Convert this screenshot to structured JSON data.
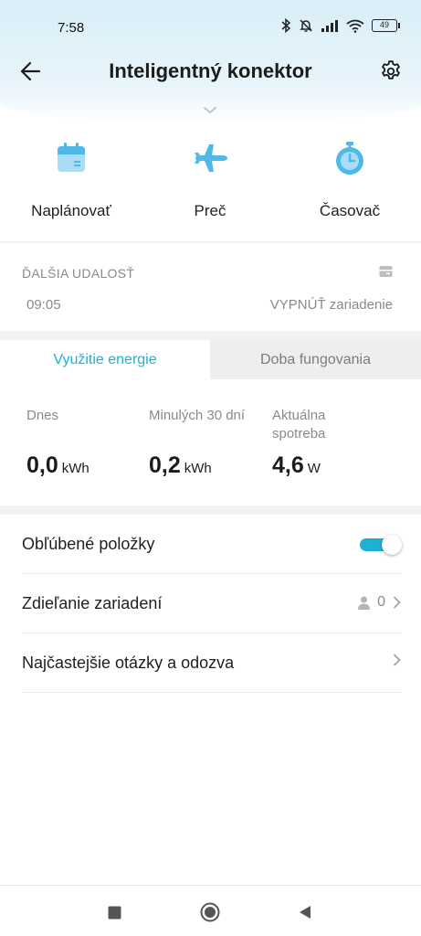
{
  "status_bar": {
    "time": "7:58",
    "battery": "49"
  },
  "header": {
    "title": "Inteligentný konektor"
  },
  "actions": [
    {
      "label": "Naplánovať",
      "icon": "calendar-icon"
    },
    {
      "label": "Preč",
      "icon": "airplane-icon"
    },
    {
      "label": "Časovač",
      "icon": "timer-icon"
    }
  ],
  "next_event": {
    "title": "ĎALŠIA UDALOSŤ",
    "time": "09:05",
    "action": "VYPNÚŤ zariadenie"
  },
  "tabs": {
    "active": "Využitie energie",
    "inactive": "Doba fungovania"
  },
  "energy": [
    {
      "label": "Dnes",
      "value": "0,0",
      "unit": "kWh"
    },
    {
      "label": "Minulých 30 dní",
      "value": "0,2",
      "unit": "kWh"
    },
    {
      "label": "Aktuálna spotreba",
      "value": "4,6",
      "unit": "W"
    }
  ],
  "list": {
    "favorites": {
      "label": "Obľúbené položky",
      "toggle_on": true
    },
    "sharing": {
      "label": "Zdieľanie zariadení",
      "count": "0"
    },
    "faq": {
      "label": "Najčastejšie otázky a odozva"
    }
  },
  "colors": {
    "accent": "#1fb0d6",
    "header_bg": "#d9eef8",
    "icon_blue": "#4fb9e8"
  }
}
